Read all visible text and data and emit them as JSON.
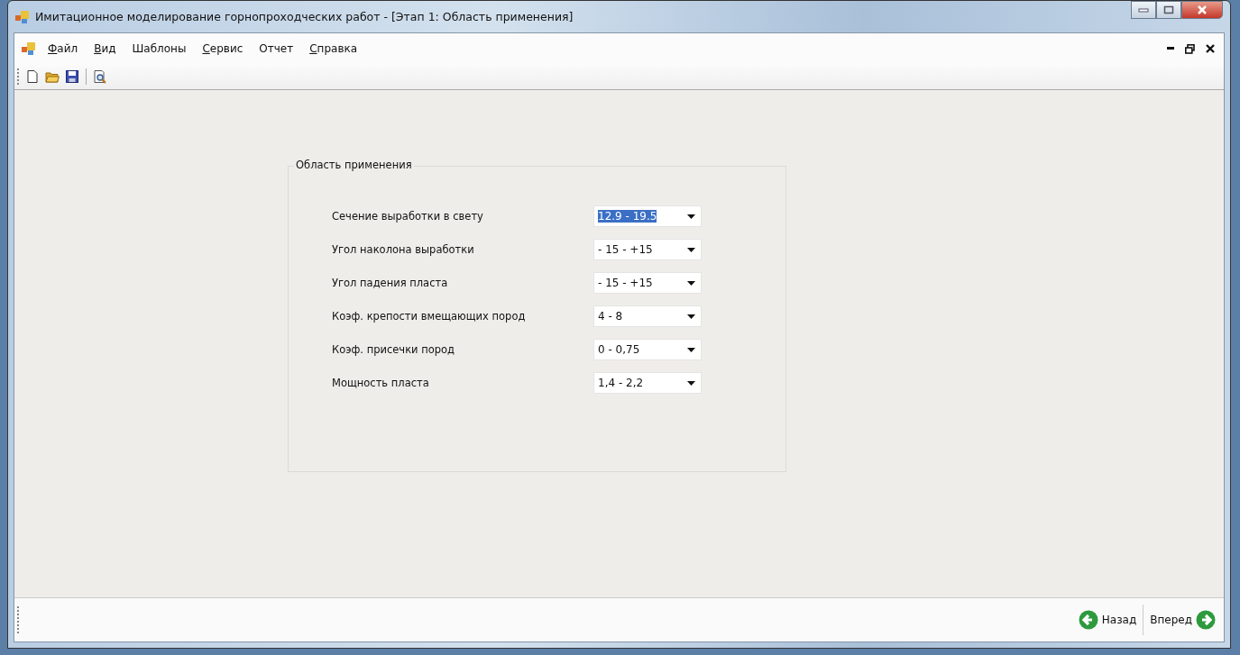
{
  "window": {
    "title": "Имитационное моделирование горнопроходческих работ - [Этап 1: Область применения]"
  },
  "menu": [
    {
      "label": "Файл",
      "mnemonic": true
    },
    {
      "label": "Вид",
      "mnemonic": true
    },
    {
      "label": "Шаблоны",
      "mnemonic": false
    },
    {
      "label": "Сервис",
      "mnemonic": true
    },
    {
      "label": "Отчет",
      "mnemonic": false
    },
    {
      "label": "Справка",
      "mnemonic": true
    }
  ],
  "toolbar": [
    {
      "kind": "new"
    },
    {
      "kind": "open"
    },
    {
      "kind": "save"
    },
    {
      "kind": "separator"
    },
    {
      "kind": "preview"
    }
  ],
  "group": {
    "title": "Область применения",
    "fields": [
      {
        "label": "Сечение выработки в свету",
        "value": "12.9 - 19.5",
        "focused": true
      },
      {
        "label": "Угол наколона выработки",
        "value": "- 15 - +15",
        "focused": false
      },
      {
        "label": "Угол падения пласта",
        "value": "- 15 - +15",
        "focused": false
      },
      {
        "label": "Коэф. крепости вмещающих пород",
        "value": "4 - 8",
        "focused": false
      },
      {
        "label": "Коэф. присечки пород",
        "value": "0 - 0,75",
        "focused": false
      },
      {
        "label": "Мощность пласта",
        "value": "1,4 - 2,2",
        "focused": false
      }
    ]
  },
  "nav_buttons": [
    {
      "label": "Назад",
      "kind": "back"
    },
    {
      "label": "Вперед",
      "kind": "forward"
    }
  ]
}
